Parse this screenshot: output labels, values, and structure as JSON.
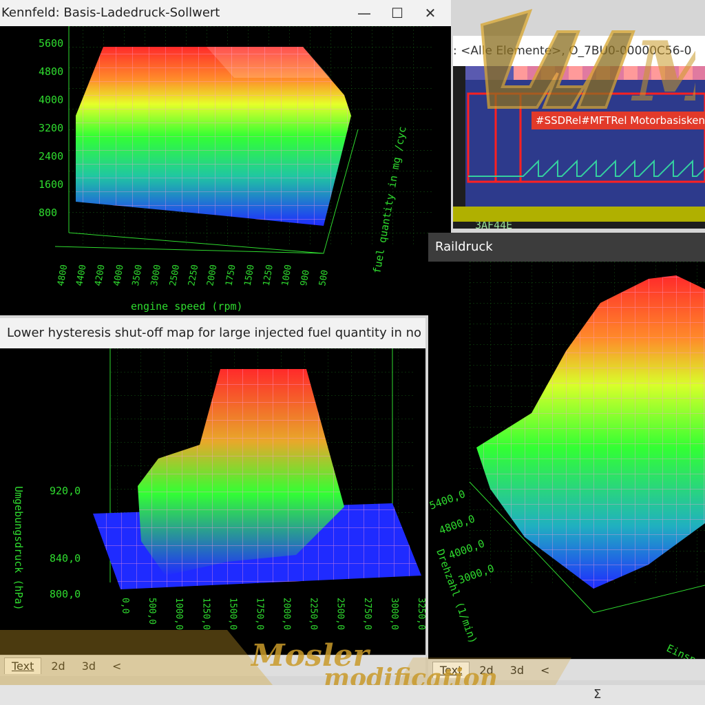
{
  "window1": {
    "title": "Kennfeld: Basis-Ladedruck-Sollwert",
    "minimize_glyph": "—",
    "maximize_glyph": "☐",
    "close_glyph": "✕",
    "z_ticks": [
      "5600",
      "4800",
      "4000",
      "3200",
      "2400",
      "1600",
      "800"
    ],
    "x_ticks": [
      "4800",
      "4400",
      "4200",
      "4000",
      "3500",
      "3000",
      "2500",
      "2250",
      "2000",
      "1750",
      "1500",
      "1250",
      "1000",
      "900",
      "500"
    ],
    "x_label": "engine speed (rpm)",
    "y_label": "fuel quantity in mg /cyc"
  },
  "trace_panel": {
    "breadcrumb": ": <Alle Elemente>, O_7BU0-00000C56-0",
    "label": "#SSDRel#MFTRel Motorbasiskenn",
    "address": "3AF44E"
  },
  "window2": {
    "title": "Lower hysteresis shut-off map for large injected fuel quantity in no",
    "z_ticks": [
      "920,0",
      "840,0",
      "800,0"
    ],
    "x_ticks": [
      "0,0",
      "500,0",
      "1000,0",
      "1250,0",
      "1500,0",
      "1750,0",
      "2000,0",
      "2250,0",
      "2500,0",
      "2750,0",
      "3000,0",
      "3250,0"
    ],
    "z_label": "Umgebungsdruck (hPa)",
    "tabs": [
      "Text",
      "2d",
      "3d"
    ],
    "tab_arrow": "<"
  },
  "window3": {
    "title": "Raildruck",
    "y_ticks": [
      "5400,0",
      "4800,0",
      "4000,0",
      "3000,0"
    ],
    "y_label": "Drehzahl (1/min)",
    "x_label": "Einspr",
    "tabs": [
      "Text",
      "2d",
      "3d"
    ],
    "tab_arrow": "<"
  },
  "watermark": {
    "line1": "Mosler",
    "line2": "modification",
    "logo_letters": "M"
  },
  "statusbar": {
    "sigma": "Σ"
  },
  "colors": {
    "grid_green": "#2fdc2f",
    "surface_hot": "#ff2a2a",
    "surface_mid": "#33ff33",
    "surface_low": "#1f2bff",
    "watermark_gold": "#d8a52c"
  }
}
